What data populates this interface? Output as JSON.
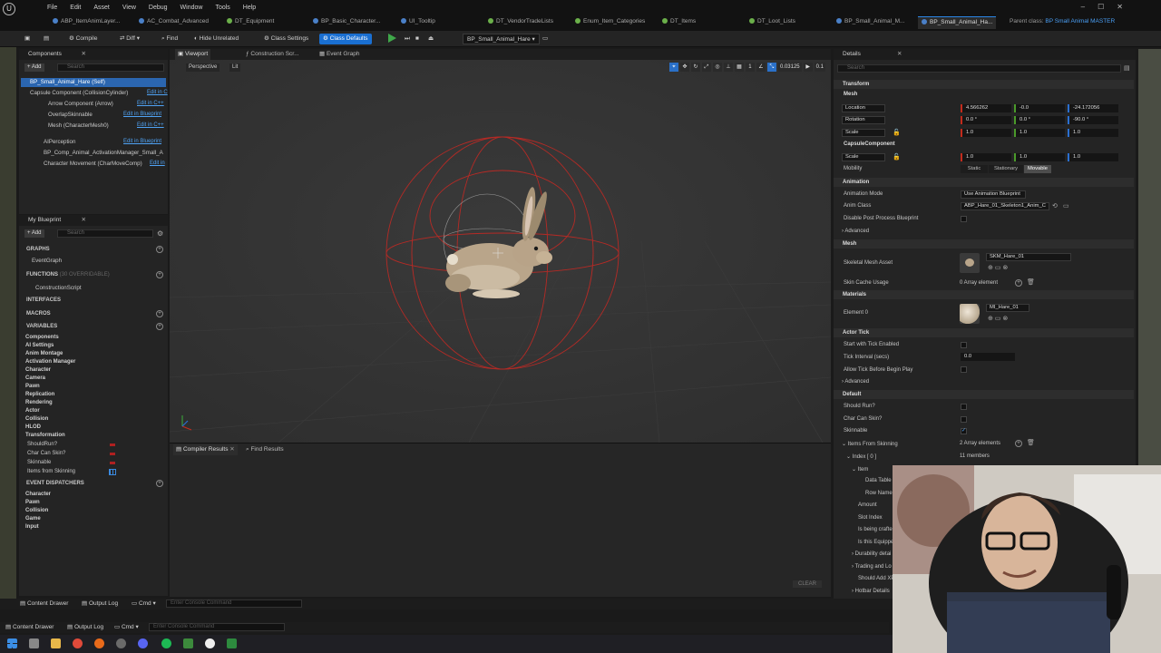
{
  "menubar": {
    "items": [
      "File",
      "Edit",
      "Asset",
      "View",
      "Debug",
      "Window",
      "Tools",
      "Help"
    ],
    "parent_class_label": "Parent class:",
    "parent_class_value": "BP Small Animal MASTER"
  },
  "tabs": [
    "ABP_ItemAnimLayer...",
    "AC_Combat_Advanced",
    "DT_Equipment",
    "BP_Basic_Character...",
    "UI_Tooltip",
    "DT_VendorTradeLists",
    "Enum_Item_Categories",
    "DT_Items",
    "DT_Loot_Lists",
    "BP_Small_Animal_M...",
    "BP_Small_Animal_Ha..."
  ],
  "toolbar": {
    "compile": "Compile",
    "diff": "Diff",
    "find": "Find",
    "hide_unrelated": "Hide Unrelated",
    "class_settings": "Class Settings",
    "class_defaults": "Class Defaults",
    "debug_object": "BP_Small_Animal_Hare"
  },
  "components": {
    "title": "Components",
    "add": "+ Add",
    "search_placeholder": "Search",
    "root": "BP_Small_Animal_Hare (Self)",
    "items": [
      {
        "label": "Capsule Component (CollisionCylinder)",
        "link": "Edit in C"
      },
      {
        "label": "Arrow Component (Arrow)",
        "link": "Edit in C++"
      },
      {
        "label": "OverlapSkinnable",
        "link": "Edit in Blueprint"
      },
      {
        "label": "Mesh (CharacterMesh0)",
        "link": "Edit in C++"
      },
      {
        "label": "AIPerception",
        "link": "Edit in Blueprint"
      },
      {
        "label": "BP_Comp_Animal_ActivationManager_Small_A",
        "link": ""
      },
      {
        "label": "Character Movement (CharMoveComp)",
        "link": "Edit in"
      }
    ]
  },
  "my_blueprint": {
    "title": "My Blueprint",
    "add": "+ Add",
    "search_placeholder": "Search",
    "graphs": "GRAPHS",
    "event_graph": "EventGraph",
    "functions": "FUNCTIONS",
    "functions_count": "(30 OVERRIDABLE)",
    "construction_script": "ConstructionScript",
    "interfaces": "INTERFACES",
    "macros": "MACROS",
    "variables": "VARIABLES",
    "variable_groups": [
      "Components",
      "AI Settings",
      "Anim Montage",
      "Activation Manager",
      "Character",
      "Camera",
      "Pawn",
      "Replication",
      "Rendering",
      "Actor",
      "Collision",
      "HLOD",
      "Transformation"
    ],
    "variable_leaves": [
      "ShouldRun?",
      "Char Can Skin?",
      "Skinnable",
      "Items from Skinning"
    ],
    "event_dispatchers": "EVENT DISPATCHERS",
    "dispatcher_groups": [
      "Character",
      "Pawn",
      "Collision",
      "Game",
      "Input"
    ]
  },
  "viewport": {
    "tabs": [
      "Viewport",
      "Construction Scr...",
      "Event Graph"
    ],
    "perspective": "Perspective",
    "lit": "Lit",
    "snap_value": "0.03125",
    "camera_speed": "0.1",
    "grid_value": "1"
  },
  "bottom": {
    "tabs": [
      "Compiler Results",
      "Find Results"
    ],
    "clear": "CLEAR"
  },
  "status": {
    "content_drawer": "Content Drawer",
    "output_log": "Output Log",
    "cmd": "Cmd",
    "console_placeholder": "Enter Console Command"
  },
  "details": {
    "title": "Details",
    "search_placeholder": "Search",
    "transform": "Transform",
    "mesh_sub": "Mesh",
    "location_label": "Location",
    "location": [
      "4.566262",
      "-0.0",
      "-24.172056"
    ],
    "rotation_label": "Rotation",
    "rotation": [
      "0.0 °",
      "0.0 °",
      "-90.0 °"
    ],
    "scale_label": "Scale",
    "scale": [
      "1.0",
      "1.0",
      "1.0"
    ],
    "capsule_sub": "CapsuleComponent",
    "capsule_scale": [
      "1.0",
      "1.0",
      "1.0"
    ],
    "mobility_label": "Mobility",
    "mobility": [
      "Static",
      "Stationary",
      "Movable"
    ],
    "animation": "Animation",
    "anim_mode_label": "Animation Mode",
    "anim_mode": "Use Animation Blueprint",
    "anim_class_label": "Anim Class",
    "anim_class": "ABP_Hare_01_Skeleton1_Anim_C",
    "disable_pp_label": "Disable Post Process Blueprint",
    "advanced": "Advanced",
    "mesh": "Mesh",
    "skeletal_mesh_label": "Skeletal Mesh Asset",
    "skeletal_mesh": "SKM_Hare_01",
    "skin_cache_label": "Skin Cache Usage",
    "skin_cache": "0 Array element",
    "materials": "Materials",
    "element0_label": "Element 0",
    "element0": "MI_Hare_01",
    "actor_tick": "Actor Tick",
    "start_tick_label": "Start with Tick Enabled",
    "tick_interval_label": "Tick Interval (secs)",
    "tick_interval": "0.0",
    "allow_tick_label": "Allow Tick Before Begin Play",
    "advanced2": "Advanced",
    "default": "Default",
    "should_run_label": "Should Run?",
    "char_can_skin_label": "Char Can Skin?",
    "skinnable_label": "Skinnable",
    "items_skinning_label": "Items From Skinning",
    "items_skinning": "2 Array elements",
    "index0_label": "Index [ 0 ]",
    "index0": "11 members",
    "item_label": "Item",
    "data_table_label": "Data Table",
    "row_name_label": "Row Name",
    "amount_label": "Amount",
    "slot_index_label": "Slot Index",
    "is_crafted_label": "Is being crafted",
    "is_equipped_label": "Is this Equippe",
    "durability_label": "Durability detai",
    "trading_label": "Trading and Lo",
    "should_add_xp_label": "Should Add XP",
    "hotbar_label": "Hotbar Details"
  },
  "colors": {
    "accent": "#2a86e8",
    "selection": "#2b66b0",
    "panel": "#242424",
    "viewport": "#333333",
    "capsule": "#c0302a"
  }
}
